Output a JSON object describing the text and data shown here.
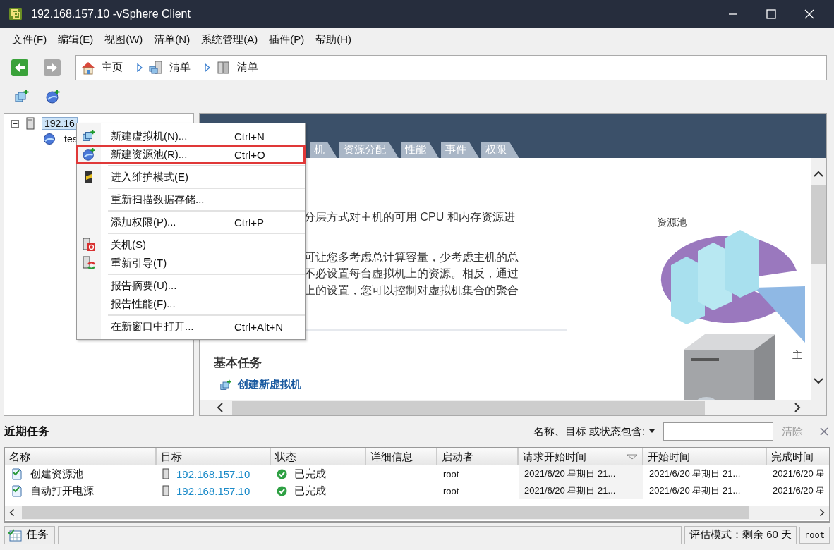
{
  "window": {
    "title": "192.168.157.10  -vSphere Client"
  },
  "menu_bar": [
    "文件(F)",
    "编辑(E)",
    "视图(W)",
    "清单(N)",
    "系统管理(A)",
    "插件(P)",
    "帮助(H)"
  ],
  "breadcrumb": [
    "主页",
    "清单",
    "清单"
  ],
  "tree": [
    {
      "label": "192.16",
      "selected": true,
      "expanded": true,
      "children": [
        {
          "label": "tes",
          "selected": false
        }
      ]
    }
  ],
  "context_menu": {
    "groups": [
      [
        {
          "label": "新建虚拟机(N)...",
          "shortcut": "Ctrl+N",
          "selected": false
        },
        {
          "label": "新建资源池(R)...",
          "shortcut": "Ctrl+O",
          "selected": true
        }
      ],
      [
        {
          "label": "进入维护模式(E)",
          "selected": false
        }
      ],
      [
        {
          "label": "重新扫描数据存储...",
          "selected": false
        }
      ],
      [
        {
          "label": "添加权限(P)...",
          "shortcut": "Ctrl+P",
          "selected": false
        }
      ],
      [
        {
          "label": "关机(S)",
          "selected": false
        },
        {
          "label": "重新引导(T)",
          "selected": false
        }
      ],
      [
        {
          "label": "报告摘要(U)...",
          "selected": false
        },
        {
          "label": "报告性能(F)...",
          "selected": false
        }
      ],
      [
        {
          "label": "在新窗口中打开...",
          "shortcut": "Ctrl+Alt+N",
          "selected": false
        }
      ]
    ]
  },
  "tabs": [
    {
      "label": "机",
      "selected": false
    },
    {
      "label": "资源分配",
      "selected": false
    },
    {
      "label": "性能",
      "selected": false
    },
    {
      "label": "事件",
      "selected": false
    },
    {
      "label": "权限",
      "selected": false
    }
  ],
  "intro": {
    "paragraphs": [
      [
        "分层方式对主机的可用 CPU 和内存资源进"
      ],
      [
        "可让您多考虑总计算容量，少考虑主机的总",
        "不必设置每台虚拟机上的资源。相反，通过",
        "上的设置，您可以控制对虚拟机集合的聚合"
      ]
    ],
    "figure_labels": [
      "资源池",
      "主"
    ],
    "basic_tasks_title": "基本任务",
    "tasks": [
      "创建新虚拟机"
    ]
  },
  "recent_tasks": {
    "title": "近期任务",
    "filter_label": "名称、目标 或状态包含:",
    "clear": "清除",
    "columns": [
      {
        "label": "名称",
        "sorted": false
      },
      {
        "label": "目标",
        "sorted": false
      },
      {
        "label": "状态",
        "sorted": false
      },
      {
        "label": "详细信息",
        "sorted": false
      },
      {
        "label": "启动者",
        "sorted": false
      },
      {
        "label": "请求开始时间",
        "sorted": true
      },
      {
        "label": "开始时间",
        "sorted": false
      },
      {
        "label": "完成时间",
        "sorted": false
      }
    ],
    "rows": [
      [
        "创建资源池",
        "192.168.157.10",
        "已完成",
        "",
        "root",
        "2021/6/20 星期日 21...",
        "2021/6/20 星期日 21...",
        "2021/6/20 星"
      ],
      [
        "自动打开电源",
        "192.168.157.10",
        "已完成",
        "",
        "root",
        "2021/6/20 星期日 21...",
        "2021/6/20 星期日 21...",
        "2021/6/20 星"
      ]
    ]
  },
  "status_bar": {
    "tasks_button": "任务",
    "mode": "评估模式：剩余 60 天",
    "user": "root"
  }
}
